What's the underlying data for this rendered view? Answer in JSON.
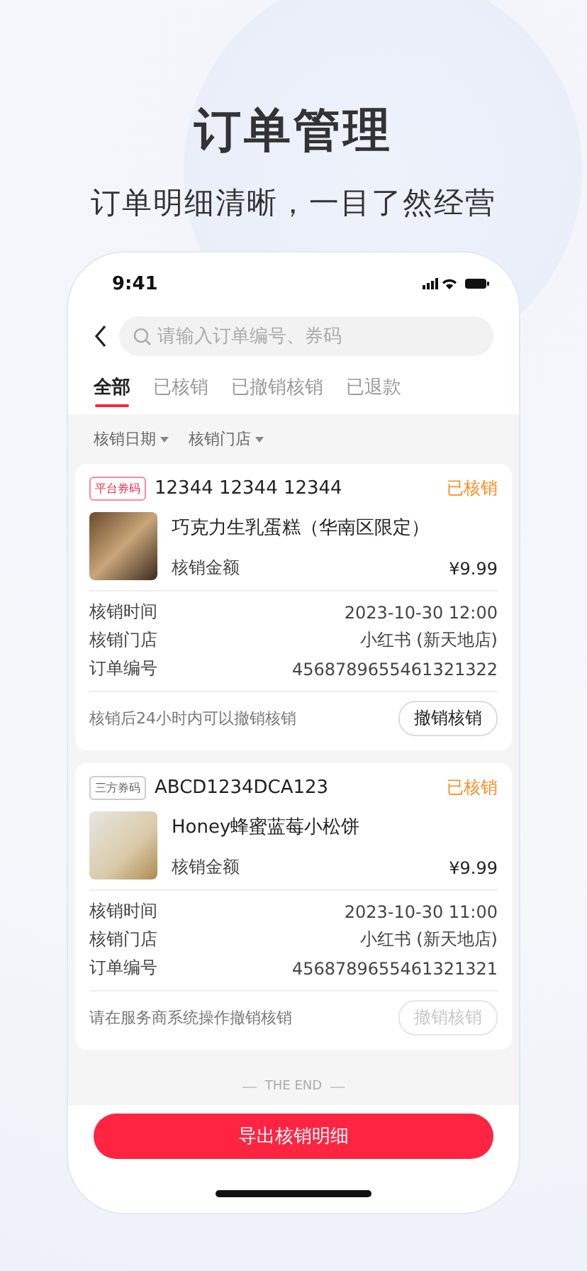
{
  "headline": "订单管理",
  "subheadline": "订单明细清晰，一目了然经营",
  "status_bar": {
    "time": "9:41"
  },
  "search": {
    "placeholder": "请输入订单编号、券码"
  },
  "tabs": [
    {
      "label": "全部",
      "selected": true
    },
    {
      "label": "已核销",
      "selected": false
    },
    {
      "label": "已撤销核销",
      "selected": false
    },
    {
      "label": "已退款",
      "selected": false
    }
  ],
  "filters": [
    {
      "label": "核销日期"
    },
    {
      "label": "核销门店"
    }
  ],
  "orders": [
    {
      "tag": {
        "label": "平台券码",
        "kind": "platform"
      },
      "code": "12344 12344 12344",
      "status": "已核销",
      "product": "巧克力生乳蛋糕（华南区限定）",
      "amount_label": "核销金额",
      "amount": "¥9.99",
      "details": [
        {
          "label": "核销时间",
          "value": "2023-10-30 12:00"
        },
        {
          "label": "核销门店",
          "value": "小红书 (新天地店)"
        },
        {
          "label": "订单编号",
          "value": "4568789655461321322"
        }
      ],
      "note": "核销后24小时内可以撤销核销",
      "cancel_button": {
        "label": "撤销核销",
        "disabled": false
      }
    },
    {
      "tag": {
        "label": "三方券码",
        "kind": "third-party"
      },
      "code": "ABCD1234DCA123",
      "status": "已核销",
      "product": "Honey蜂蜜蓝莓小松饼",
      "amount_label": "核销金额",
      "amount": "¥9.99",
      "details": [
        {
          "label": "核销时间",
          "value": "2023-10-30 11:00"
        },
        {
          "label": "核销门店",
          "value": "小红书 (新天地店)"
        },
        {
          "label": "订单编号",
          "value": "4568789655461321321"
        }
      ],
      "note": "请在服务商系统操作撤销核销",
      "cancel_button": {
        "label": "撤销核销",
        "disabled": true
      }
    }
  ],
  "end_text": "THE END",
  "export_button": {
    "label": "导出核销明细"
  }
}
